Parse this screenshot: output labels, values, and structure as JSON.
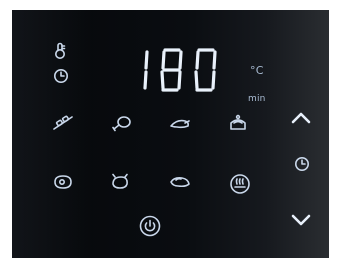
{
  "display": {
    "temperature_value": "180",
    "unit_celsius": "°C",
    "unit_minutes": "min"
  },
  "icons": {
    "thermometer": "thermometer-icon",
    "clock_left": "clock-icon",
    "clock_right": "clock-icon",
    "skewer": "skewer-icon",
    "chicken_leg": "chicken-leg-icon",
    "shrimp": "shrimp-icon",
    "cake": "cake-icon",
    "steak": "steak-icon",
    "whole_chicken": "whole-chicken-icon",
    "fish": "fish-icon",
    "defrost": "defrost-icon",
    "power": "power-icon",
    "arrow_up": "chevron-up-icon",
    "arrow_down": "chevron-down-icon"
  },
  "colors": {
    "panel_background": "#0a0d11",
    "glyph": "#c9d7ea",
    "unit_text": "#a9bcd3"
  }
}
